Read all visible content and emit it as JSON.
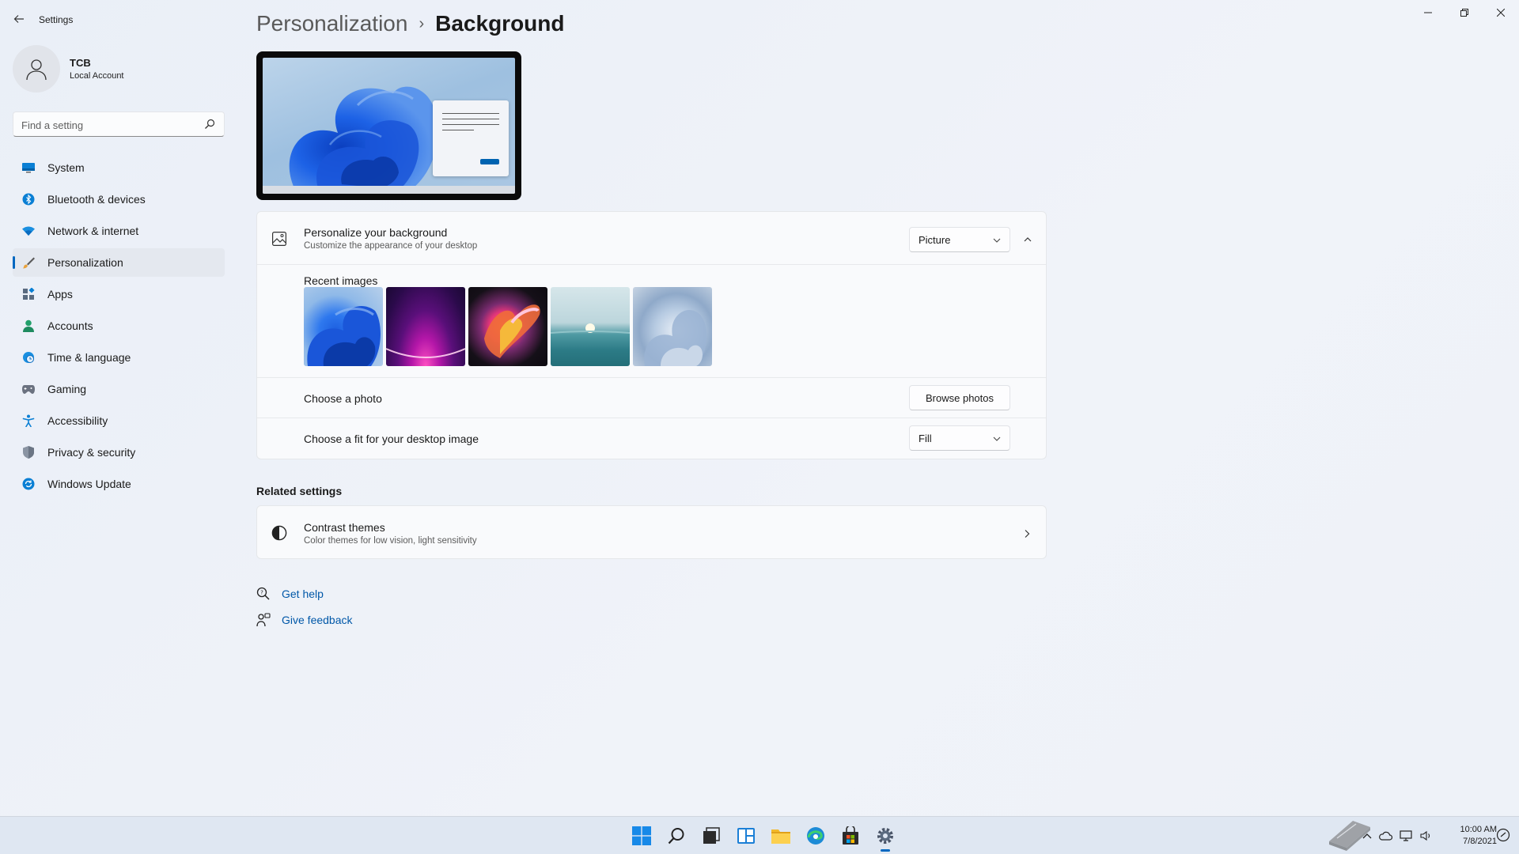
{
  "window": {
    "app_title": "Settings",
    "back_icon": "arrow-left-icon",
    "min_icon": "minimize-icon",
    "max_icon": "maximize-icon",
    "close_icon": "close-icon"
  },
  "profile": {
    "name": "TCB",
    "account_type": "Local Account"
  },
  "search": {
    "placeholder": "Find a setting"
  },
  "sidebar": {
    "items": [
      {
        "label": "System",
        "icon": "monitor-icon",
        "active": false
      },
      {
        "label": "Bluetooth & devices",
        "icon": "bluetooth-icon",
        "active": false
      },
      {
        "label": "Network & internet",
        "icon": "wifi-icon",
        "active": false
      },
      {
        "label": "Personalization",
        "icon": "brush-icon",
        "active": true
      },
      {
        "label": "Apps",
        "icon": "apps-icon",
        "active": false
      },
      {
        "label": "Accounts",
        "icon": "person-icon",
        "active": false
      },
      {
        "label": "Time & language",
        "icon": "globe-clock-icon",
        "active": false
      },
      {
        "label": "Gaming",
        "icon": "gamepad-icon",
        "active": false
      },
      {
        "label": "Accessibility",
        "icon": "accessibility-icon",
        "active": false
      },
      {
        "label": "Privacy & security",
        "icon": "shield-icon",
        "active": false
      },
      {
        "label": "Windows Update",
        "icon": "update-icon",
        "active": false
      }
    ]
  },
  "breadcrumb": {
    "parent": "Personalization",
    "separator": "›",
    "current": "Background"
  },
  "background_card": {
    "title": "Personalize your background",
    "subtitle": "Customize the appearance of your desktop",
    "type_value": "Picture",
    "recent_images_label": "Recent images",
    "recent_images": [
      "bloom-blue",
      "glow-purple",
      "flower-dark",
      "lake-sunrise",
      "bloom-light"
    ],
    "choose_photo_label": "Choose a photo",
    "browse_button": "Browse photos",
    "fit_label": "Choose a fit for your desktop image",
    "fit_value": "Fill"
  },
  "related": {
    "heading": "Related settings",
    "contrast_title": "Contrast themes",
    "contrast_subtitle": "Color themes for low vision, light sensitivity"
  },
  "links": {
    "get_help": "Get help",
    "give_feedback": "Give feedback"
  },
  "taskbar": {
    "apps": [
      "start-icon",
      "search-icon",
      "task-view-icon",
      "widgets-icon",
      "file-explorer-icon",
      "edge-icon",
      "store-icon",
      "settings-icon"
    ],
    "time": "10:00 AM",
    "date": "7/8/2021"
  },
  "colors": {
    "accent": "#0067c0",
    "link": "#0058a8"
  }
}
